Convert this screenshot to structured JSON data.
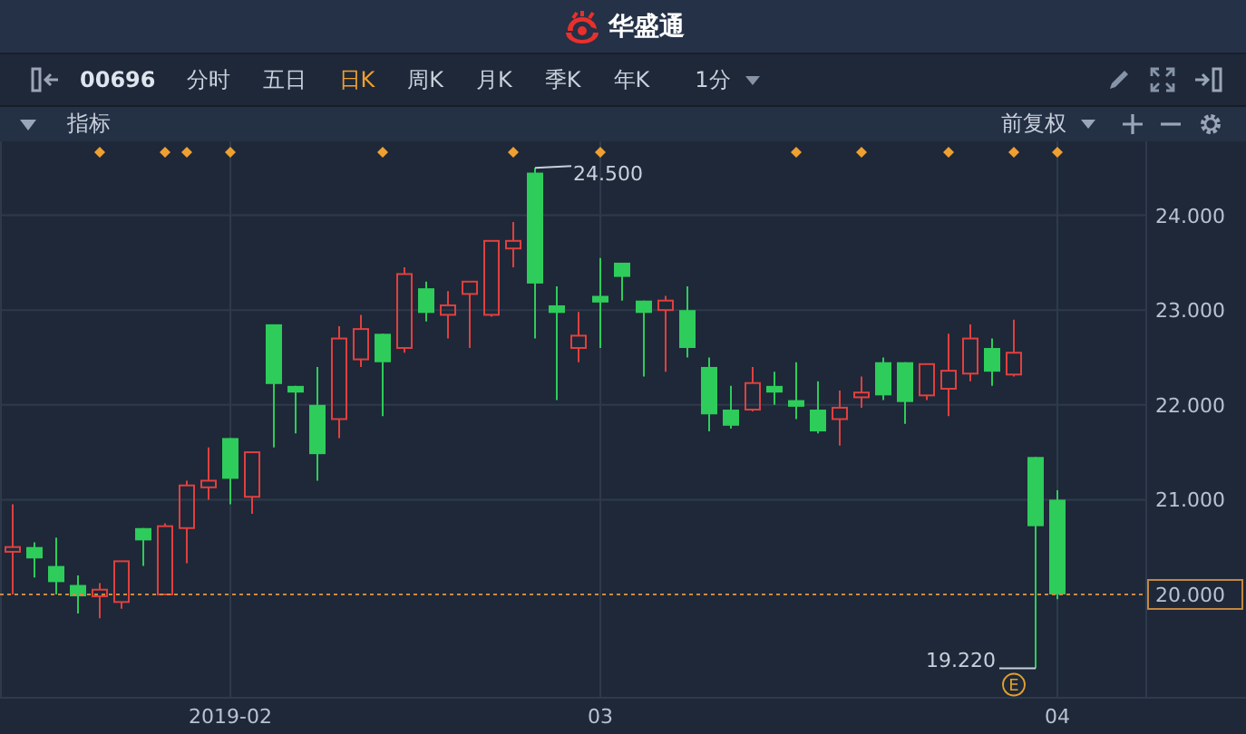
{
  "app": {
    "title": "华盛通"
  },
  "toolbar": {
    "symbol": "00696",
    "periods": [
      {
        "label": "分时",
        "selected": false
      },
      {
        "label": "五日",
        "selected": false
      },
      {
        "label": "日K",
        "selected": true
      },
      {
        "label": "周K",
        "selected": false
      },
      {
        "label": "月K",
        "selected": false
      },
      {
        "label": "季K",
        "selected": false
      },
      {
        "label": "年K",
        "selected": false
      }
    ],
    "interval": "1分"
  },
  "indicator_bar": {
    "label": "指标",
    "adjust": "前复权"
  },
  "chart": {
    "chart_data": {
      "type": "candlestick",
      "grid": true,
      "categories": [
        null,
        null,
        null,
        null,
        null,
        null,
        null,
        null,
        null,
        null,
        "2019-02",
        null,
        null,
        null,
        null,
        null,
        null,
        null,
        null,
        null,
        null,
        null,
        null,
        null,
        null,
        null,
        null,
        "03",
        null,
        null,
        null,
        null,
        null,
        null,
        null,
        null,
        null,
        null,
        null,
        null,
        null,
        null,
        null,
        null,
        null,
        null,
        null,
        null,
        "04"
      ],
      "ohlc": [
        [
          20.45,
          20.95,
          20.0,
          20.5
        ],
        [
          20.5,
          20.55,
          20.18,
          20.38
        ],
        [
          20.3,
          20.6,
          20.0,
          20.13
        ],
        [
          20.1,
          20.2,
          19.8,
          19.98
        ],
        [
          19.98,
          20.12,
          19.75,
          20.05
        ],
        [
          19.92,
          20.35,
          19.85,
          20.35
        ],
        [
          20.7,
          20.7,
          20.3,
          20.57
        ],
        [
          20.0,
          20.75,
          20.0,
          20.72
        ],
        [
          20.7,
          21.2,
          20.33,
          21.15
        ],
        [
          21.13,
          21.55,
          21.0,
          21.2
        ],
        [
          21.65,
          21.65,
          20.95,
          21.22
        ],
        [
          21.03,
          21.5,
          20.85,
          21.5
        ],
        [
          22.85,
          22.85,
          21.55,
          22.22
        ],
        [
          22.2,
          22.2,
          21.7,
          22.13
        ],
        [
          22.0,
          22.4,
          21.2,
          21.48
        ],
        [
          21.85,
          22.83,
          21.65,
          22.7
        ],
        [
          22.48,
          22.95,
          22.4,
          22.8
        ],
        [
          22.75,
          22.75,
          21.88,
          22.45
        ],
        [
          22.6,
          23.45,
          22.55,
          23.38
        ],
        [
          23.23,
          23.3,
          22.88,
          22.97
        ],
        [
          22.95,
          23.2,
          22.7,
          23.05
        ],
        [
          23.17,
          23.3,
          22.6,
          23.3
        ],
        [
          22.95,
          23.73,
          22.93,
          23.73
        ],
        [
          23.65,
          23.93,
          23.45,
          23.73
        ],
        [
          24.45,
          24.5,
          22.7,
          23.28
        ],
        [
          23.05,
          23.25,
          22.05,
          22.97
        ],
        [
          22.6,
          22.98,
          22.45,
          22.73
        ],
        [
          23.15,
          23.55,
          22.6,
          23.08
        ],
        [
          23.5,
          23.5,
          23.1,
          23.35
        ],
        [
          23.1,
          23.1,
          22.3,
          22.97
        ],
        [
          23.0,
          23.15,
          22.35,
          23.1
        ],
        [
          23.0,
          23.25,
          22.5,
          22.6
        ],
        [
          22.4,
          22.5,
          21.72,
          21.9
        ],
        [
          21.95,
          22.2,
          21.75,
          21.78
        ],
        [
          21.95,
          22.4,
          21.93,
          22.23
        ],
        [
          22.2,
          22.35,
          22.0,
          22.13
        ],
        [
          22.05,
          22.45,
          21.85,
          21.98
        ],
        [
          21.95,
          22.25,
          21.7,
          21.72
        ],
        [
          21.85,
          22.15,
          21.57,
          21.97
        ],
        [
          22.08,
          22.3,
          21.97,
          22.13
        ],
        [
          22.45,
          22.5,
          22.05,
          22.1
        ],
        [
          22.45,
          22.45,
          21.8,
          22.03
        ],
        [
          22.1,
          22.43,
          22.05,
          22.43
        ],
        [
          22.17,
          22.75,
          21.88,
          22.36
        ],
        [
          22.33,
          22.85,
          22.25,
          22.7
        ],
        [
          22.6,
          22.7,
          22.2,
          22.35
        ],
        [
          22.32,
          22.9,
          22.3,
          22.55
        ],
        [
          21.45,
          21.45,
          19.22,
          20.72
        ],
        [
          21.0,
          21.1,
          19.95,
          20.0
        ]
      ],
      "ylim": [
        18.91,
        24.78
      ],
      "yticks": [
        {
          "value": 24,
          "label": "24.000"
        },
        {
          "value": 23,
          "label": "23.000"
        },
        {
          "value": 22,
          "label": "22.000"
        },
        {
          "value": 21,
          "label": "21.000"
        }
      ],
      "ref_lines": [
        {
          "axis": "y",
          "value": 20,
          "label": "20.000"
        }
      ],
      "annotations": [
        "24.500",
        "19.220"
      ]
    },
    "earnings_badge": "E"
  }
}
